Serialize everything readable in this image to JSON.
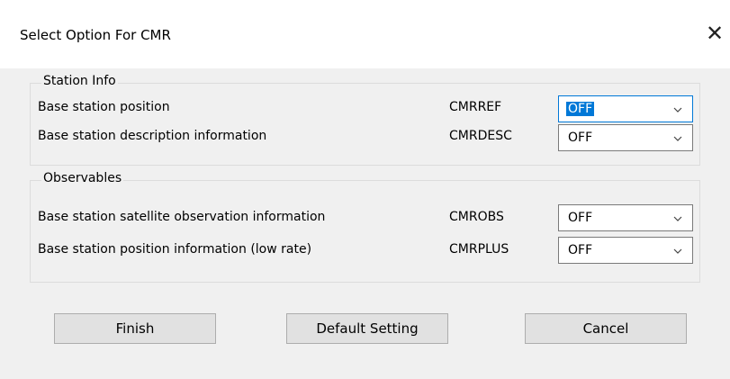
{
  "window": {
    "title": "Select Option For CMR",
    "close_icon": "close-icon"
  },
  "groups": [
    {
      "legend": "Station Info",
      "rows": [
        {
          "label": "Base station position",
          "code": "CMRREF",
          "value": "OFF",
          "focused": true
        },
        {
          "label": "Base station description information",
          "code": "CMRDESC",
          "value": "OFF",
          "focused": false
        }
      ]
    },
    {
      "legend": "Observables",
      "rows": [
        {
          "label": "Base station satellite observation information",
          "code": "CMROBS",
          "value": "OFF",
          "focused": false
        },
        {
          "label": "Base station position information (low rate)",
          "code": "CMRPLUS",
          "value": "OFF",
          "focused": false
        }
      ]
    }
  ],
  "buttons": {
    "finish": "Finish",
    "default": "Default Setting",
    "cancel": "Cancel"
  },
  "colors": {
    "focus_accent": "#0078d7",
    "dialog_bg": "#f0f0f0",
    "button_bg": "#e1e1e1"
  }
}
